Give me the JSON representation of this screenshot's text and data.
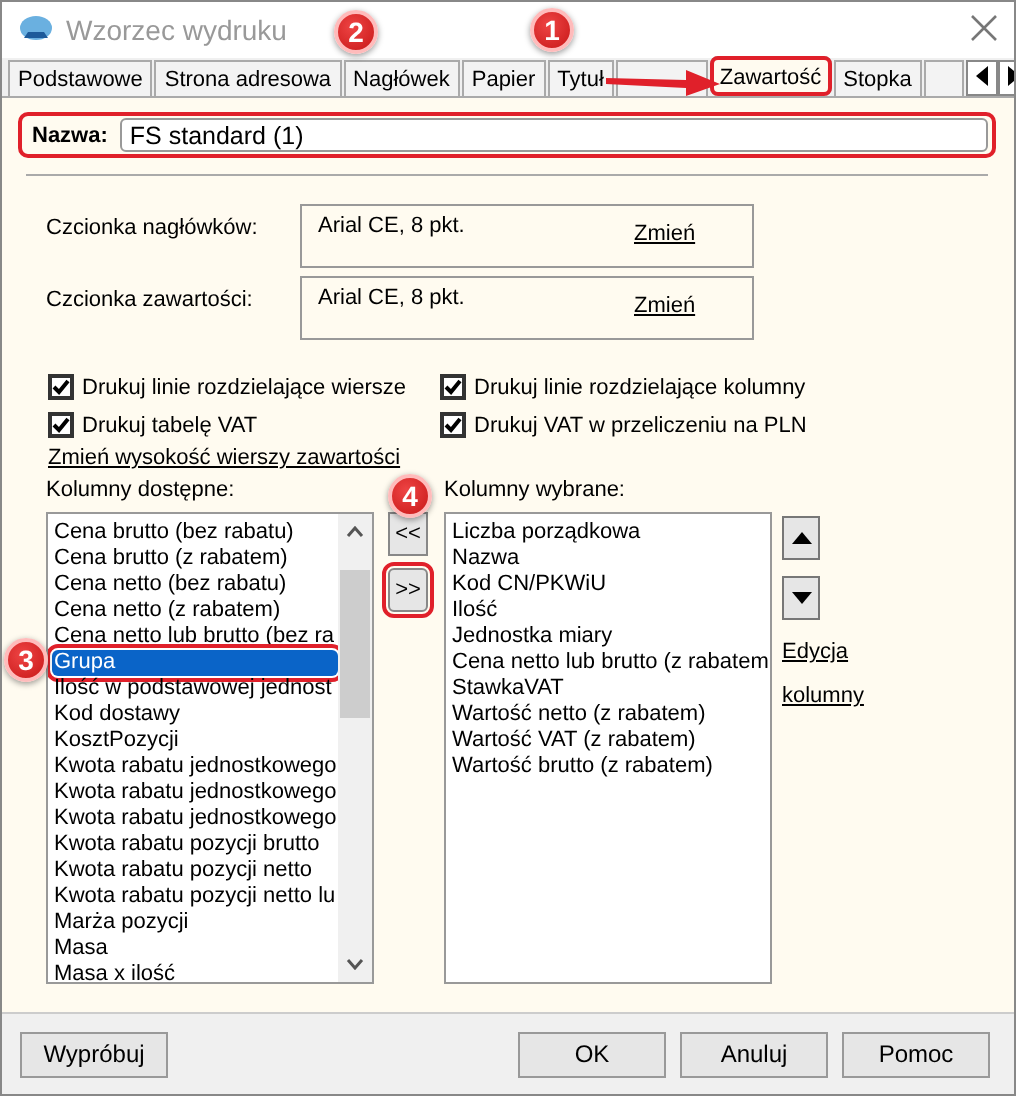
{
  "window": {
    "title": "Wzorzec wydruku"
  },
  "tabs": [
    {
      "label": "Podstawowe",
      "selected": false,
      "highlighted": false
    },
    {
      "label": "Strona adresowa",
      "selected": false,
      "highlighted": false
    },
    {
      "label": "Nagłówek",
      "selected": false,
      "highlighted": false
    },
    {
      "label": "Papier",
      "selected": false,
      "highlighted": false
    },
    {
      "label": "Tytuł",
      "selected": false,
      "highlighted": false
    },
    {
      "selected": false,
      "highlighted": false
    },
    {
      "label": "Zawartość",
      "selected": true,
      "highlighted": true
    },
    {
      "label": "Stopka",
      "selected": false,
      "highlighted": false
    },
    {
      "selected": false,
      "highlighted": false
    }
  ],
  "name_field": {
    "label": "Nazwa:",
    "value": "FS standard (1)",
    "highlighted": true
  },
  "fonts": [
    {
      "label": "Czcionka nagłówków:",
      "value": "Arial CE, 8 pkt.",
      "link": "Zmień"
    },
    {
      "label": "Czcionka zawartości:",
      "value": "Arial CE, 8 pkt.",
      "link": "Zmień"
    }
  ],
  "options": [
    {
      "label": "Drukuj linie rozdzielające wiersze",
      "checked": true
    },
    {
      "label": "Drukuj linie rozdzielające kolumny",
      "checked": true
    },
    {
      "label": "Drukuj tabelę VAT",
      "checked": true
    },
    {
      "label": "Drukuj VAT w przeliczeniu na PLN",
      "checked": true
    }
  ],
  "row_height_link": "Zmień wysokość wierszy zawartości",
  "available": {
    "label": "Kolumny dostępne:",
    "items": [
      {
        "text": "Cena brutto (bez rabatu)",
        "selected": false,
        "highlighted": false
      },
      {
        "text": "Cena brutto (z rabatem)",
        "selected": false,
        "highlighted": false
      },
      {
        "text": "Cena netto (bez rabatu)",
        "selected": false,
        "highlighted": false
      },
      {
        "text": "Cena netto (z rabatem)",
        "selected": false,
        "highlighted": false
      },
      {
        "text": "Cena netto lub brutto (bez ra",
        "selected": false,
        "highlighted": false
      },
      {
        "text": "Grupa",
        "selected": true,
        "highlighted": true
      },
      {
        "text": "Ilość w podstawowej jednost",
        "selected": false,
        "highlighted": false
      },
      {
        "text": "Kod dostawy",
        "selected": false,
        "highlighted": false
      },
      {
        "text": "KosztPozycji",
        "selected": false,
        "highlighted": false
      },
      {
        "text": "Kwota rabatu jednostkowego",
        "selected": false,
        "highlighted": false
      },
      {
        "text": "Kwota rabatu jednostkowego",
        "selected": false,
        "highlighted": false
      },
      {
        "text": "Kwota rabatu jednostkowego",
        "selected": false,
        "highlighted": false
      },
      {
        "text": "Kwota rabatu pozycji brutto",
        "selected": false,
        "highlighted": false
      },
      {
        "text": "Kwota rabatu pozycji netto",
        "selected": false,
        "highlighted": false
      },
      {
        "text": "Kwota rabatu pozycji netto lu",
        "selected": false,
        "highlighted": false
      },
      {
        "text": "Marża pozycji",
        "selected": false,
        "highlighted": false
      },
      {
        "text": "Masa",
        "selected": false,
        "highlighted": false
      },
      {
        "text": "Masa x ilość",
        "selected": false,
        "highlighted": false
      }
    ]
  },
  "move_buttons": [
    {
      "label": "<<",
      "highlighted": false
    },
    {
      "label": ">>",
      "highlighted": true
    }
  ],
  "chosen": {
    "label": "Kolumny wybrane:",
    "items": [
      "Liczba porządkowa",
      "Nazwa",
      "Kod CN/PKWiU",
      "Ilość",
      "Jednostka miary",
      "Cena netto lub brutto (z rabatem",
      "StawkaVAT",
      "Wartość netto (z rabatem)",
      "Wartość VAT (z rabatem)",
      "Wartość brutto (z rabatem)"
    ]
  },
  "edit_links": [
    "Edycja",
    "kolumny"
  ],
  "buttons": [
    "Wypróbuj",
    "OK",
    "Anuluj",
    "Pomoc"
  ],
  "annotations": [
    "1",
    "2",
    "3",
    "4"
  ]
}
